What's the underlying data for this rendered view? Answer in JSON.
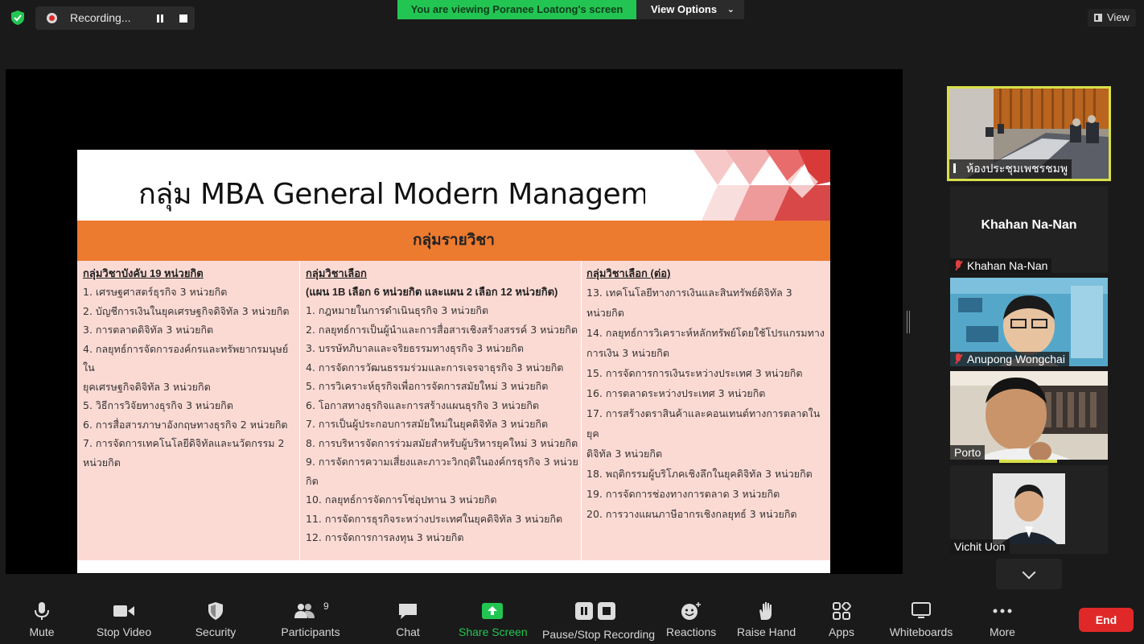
{
  "topbar": {
    "recording_label": "Recording...",
    "viewing_banner": "You are viewing Poranee Loatong's screen",
    "view_options_label": "View Options",
    "view_label": "View"
  },
  "slide": {
    "title": "กลุ่ม MBA General Modern Management",
    "band_label": "กลุ่มรายวิชา",
    "col1": {
      "heading": "กลุ่มวิชาบังคับ 19 หน่วยกิต",
      "items": [
        "1. เศรษฐศาสตร์ธุรกิจ   3 หน่วยกิต",
        "2. บัญชีการเงินในยุคเศรษฐกิจดิจิทัล 3 หน่วยกิต",
        "3. การตลาดดิจิทัล   3 หน่วยกิต",
        "4. กลยุทธ์การจัดการองค์กรและทรัพยากรมนุษย์ใน",
        "ยุคเศรษฐกิจดิจิทัล  3 หน่วยกิต",
        "5. วิธีการวิจัยทางธุรกิจ  3 หน่วยกิต",
        "6. การสื่อสารภาษาอังกฤษทางธุรกิจ  2 หน่วยกิต",
        "7. การจัดการเทคโนโลยีดิจิทัลและนวัตกรรม  2",
        "หน่วยกิต"
      ]
    },
    "col2": {
      "heading": "กลุ่มวิชาเลือก",
      "subheading": "(แผน 1B เลือก 6 หน่วยกิต และแผน 2 เลือก 12 หน่วยกิต)",
      "items": [
        "1. กฎหมายในการดำเนินธุรกิจ   3 หน่วยกิต",
        "2. กลยุทธ์การเป็นผู้นำและการสื่อสารเชิงสร้างสรรค์  3 หน่วยกิต",
        "3. บรรษัทภิบาลและจริยธรรมทางธุรกิจ  3 หน่วยกิต",
        "4. การจัดการวัฒนธรรมร่วมและการเจรจาธุรกิจ 3 หน่วยกิต",
        "5. การวิเคราะห์ธุรกิจเพื่อการจัดการสมัยใหม่  3 หน่วยกิต",
        "6. โอกาสทางธุรกิจและการสร้างแผนธุรกิจ    3 หน่วยกิต",
        "7. การเป็นผู้ประกอบการสมัยใหม่ในยุคดิจิทัล  3 หน่วยกิต",
        "8. การบริหารจัดการร่วมสมัยสำหรับผู้บริหารยุคใหม่   3 หน่วยกิต",
        "9. การจัดการความเสี่ยงและภาวะวิกฤติในองค์กรธุรกิจ   3 หน่วย",
        "กิต",
        "10. กลยุทธ์การจัดการโซ่อุปทาน   3 หน่วยกิต",
        "11. การจัดการธุรกิจระหว่างประเทศในยุคดิจิทัล  3 หน่วยกิต",
        "12. การจัดการการลงทุน  3 หน่วยกิต"
      ]
    },
    "col3": {
      "heading": "กลุ่มวิชาเลือก (ต่อ)",
      "items": [
        "13. เทคโนโลยีทางการเงินและสินทรัพย์ดิจิทัล  3 หน่วยกิต",
        "14. กลยุทธ์การวิเคราะห์หลักทรัพย์โดยใช้โปรแกรมทาง",
        "การเงิน  3 หน่วยกิต",
        "15. การจัดการการเงินระหว่างประเทศ  3 หน่วยกิต",
        "16. การตลาดระหว่างประเทศ  3 หน่วยกิต",
        "17. การสร้างตราสินค้าและคอนเทนต์ทางการตลาดในยุค",
        "ดิจิทัล   3 หน่วยกิต",
        "18. พฤติกรรมผู้บริโภคเชิงลึกในยุคดิจิทัล   3 หน่วยกิต",
        "19. การจัดการช่องทางการตลาด  3 หน่วยกิต",
        "20. การวางแผนภาษีอากรเชิงกลยุทธ์  3 หน่วยกิต"
      ]
    }
  },
  "participants": [
    {
      "name": "ห้องประชุมเพชรชมพู",
      "muted": false
    },
    {
      "name": "Khahan Na-Nan",
      "muted": true
    },
    {
      "name": "Anupong Wongchai",
      "muted": true
    },
    {
      "name": "Porto",
      "muted": false
    },
    {
      "name": "Vichit Uon",
      "muted": false
    }
  ],
  "toolbar": {
    "mute": "Mute",
    "stop_video": "Stop Video",
    "security": "Security",
    "participants": "Participants",
    "participants_count": "9",
    "chat": "Chat",
    "share_screen": "Share Screen",
    "pause_stop_recording": "Pause/Stop Recording",
    "reactions": "Reactions",
    "raise_hand": "Raise Hand",
    "apps": "Apps",
    "whiteboards": "Whiteboards",
    "more": "More",
    "end": "End"
  },
  "colors": {
    "accent_green": "#23c552",
    "end_red": "#e02828",
    "slide_band_orange": "#ec7a2f",
    "slide_table_pink": "#fcdad4",
    "active_speaker_border": "#d8e04a"
  }
}
